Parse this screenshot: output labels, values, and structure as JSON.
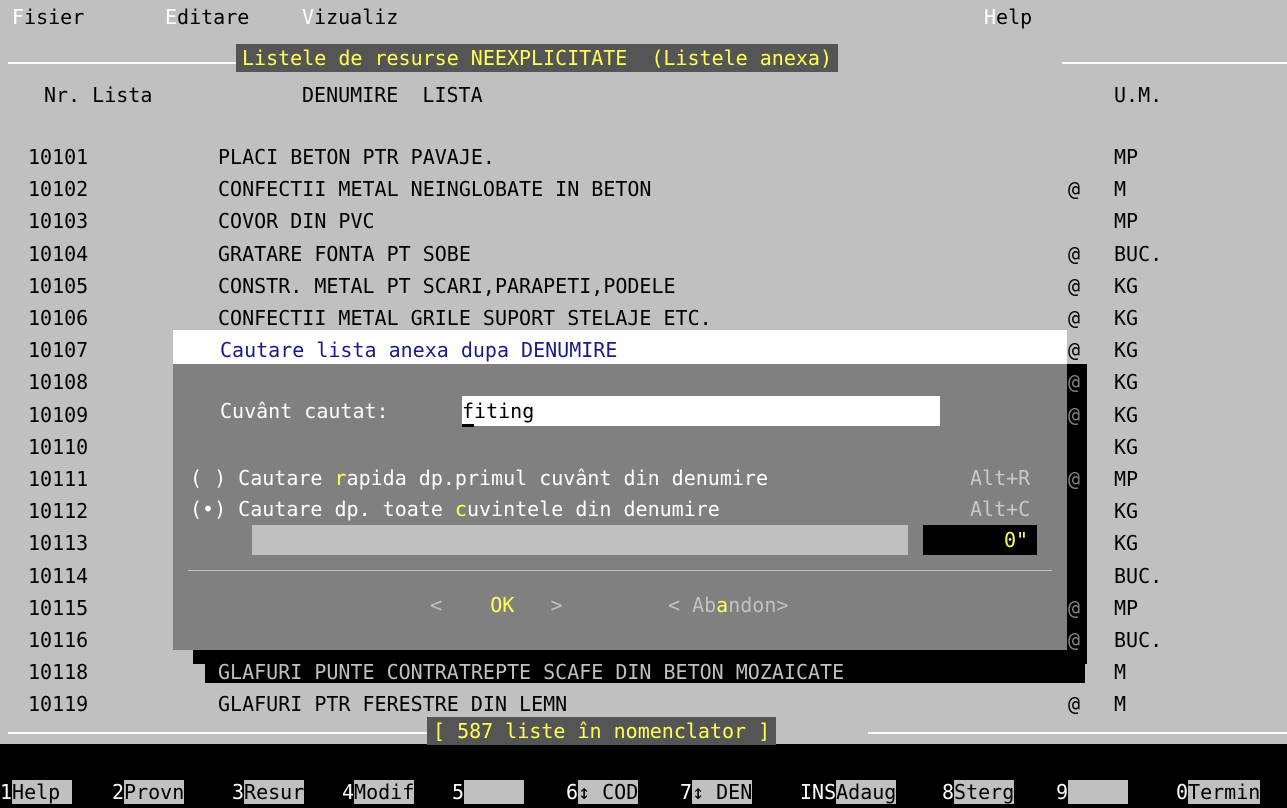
{
  "menu": {
    "file": "Fisier",
    "edit": "Editare",
    "view": "Vizualiz",
    "help": "Help"
  },
  "panel": {
    "title": "Listele de resurse NEEXPLICITATE  (Listele anexa)",
    "col_nr": "Nr. Lista",
    "col_name": "DENUMIRE  LISTA",
    "col_um": "U.M.",
    "count": "[ 587 liste în nomenclator ]"
  },
  "rows": [
    {
      "nr": "10101",
      "name": "PLACI BETON PTR PAVAJE.",
      "flag": "",
      "um": "MP"
    },
    {
      "nr": "10102",
      "name": "CONFECTII METAL NEINGLOBATE IN BETON",
      "flag": "@",
      "um": "M"
    },
    {
      "nr": "10103",
      "name": "COVOR DIN PVC",
      "flag": "",
      "um": "MP"
    },
    {
      "nr": "10104",
      "name": "GRATARE FONTA PT SOBE",
      "flag": "@",
      "um": "BUC."
    },
    {
      "nr": "10105",
      "name": "CONSTR. METAL PT SCARI,PARAPETI,PODELE",
      "flag": "@",
      "um": "KG"
    },
    {
      "nr": "10106",
      "name": "CONFECTII METAL GRILE SUPORT STELAJE ETC.",
      "flag": "@",
      "um": "KG"
    },
    {
      "nr": "10107",
      "name": "",
      "flag": "@",
      "um": "KG"
    },
    {
      "nr": "10108",
      "name": "",
      "flag": "@",
      "um": "KG"
    },
    {
      "nr": "10109",
      "name": "",
      "flag": "@",
      "um": "KG"
    },
    {
      "nr": "10110",
      "name": "",
      "flag": "",
      "um": "KG"
    },
    {
      "nr": "10111",
      "name": "",
      "flag": "@",
      "um": "MP"
    },
    {
      "nr": "10112",
      "name": "",
      "flag": "",
      "um": "KG"
    },
    {
      "nr": "10113",
      "name": "",
      "flag": "",
      "um": "KG"
    },
    {
      "nr": "10114",
      "name": "",
      "flag": "",
      "um": "BUC."
    },
    {
      "nr": "10115",
      "name": "",
      "flag": "@",
      "um": "MP"
    },
    {
      "nr": "10116",
      "name": "",
      "flag": "@",
      "um": "BUC."
    },
    {
      "nr": "10118",
      "name": "GLAFURI PUNTE CONTRATREPTE SCAFE DIN BETON MOZAICATE",
      "flag": "@",
      "um": "M"
    },
    {
      "nr": "10119",
      "name": "GLAFURI PTR FERESTRE DIN LEMN",
      "flag": "@",
      "um": "M"
    }
  ],
  "dialog": {
    "title": "Cautare lista anexa dupa DENUMIRE",
    "search_label": "Cuvânt cautat:",
    "search_value": "fiting",
    "opt1_mark": "( )",
    "opt1_pre": "Cautare ",
    "opt1_hk": "r",
    "opt1_post": "apida dp.primul cuvânt din denumire",
    "opt1_shortcut": "Alt+R",
    "opt2_mark": "(•)",
    "opt2_pre": "Cautare dp. toate ",
    "opt2_hk": "c",
    "opt2_post": "uvintele din denumire",
    "opt2_shortcut": "Alt+C",
    "time": "0\"",
    "ok_left": "<",
    "ok_label": "OK",
    "ok_right": ">",
    "abandon_pre": "< Ab",
    "abandon_hk": "a",
    "abandon_post": "ndon>"
  },
  "fkeys": [
    {
      "n": "1",
      "l": "Help "
    },
    {
      "n": "2",
      "l": "Provn"
    },
    {
      "n": "3",
      "l": "Resur"
    },
    {
      "n": "4",
      "l": "Modif"
    },
    {
      "n": "5",
      "l": "     "
    },
    {
      "n": "6",
      "l": "↕ COD"
    },
    {
      "n": "7",
      "l": "↕ DEN"
    },
    {
      "n": "INS",
      "l": "Adaug"
    },
    {
      "n": "8",
      "l": "Sterg"
    },
    {
      "n": "9",
      "l": "     "
    },
    {
      "n": "0",
      "l": "Termin"
    }
  ],
  "colors": {
    "panel": "#c0c0c0",
    "dialog": "#808080",
    "highlight": "#ffff55",
    "hotkey": "#ffff55"
  }
}
